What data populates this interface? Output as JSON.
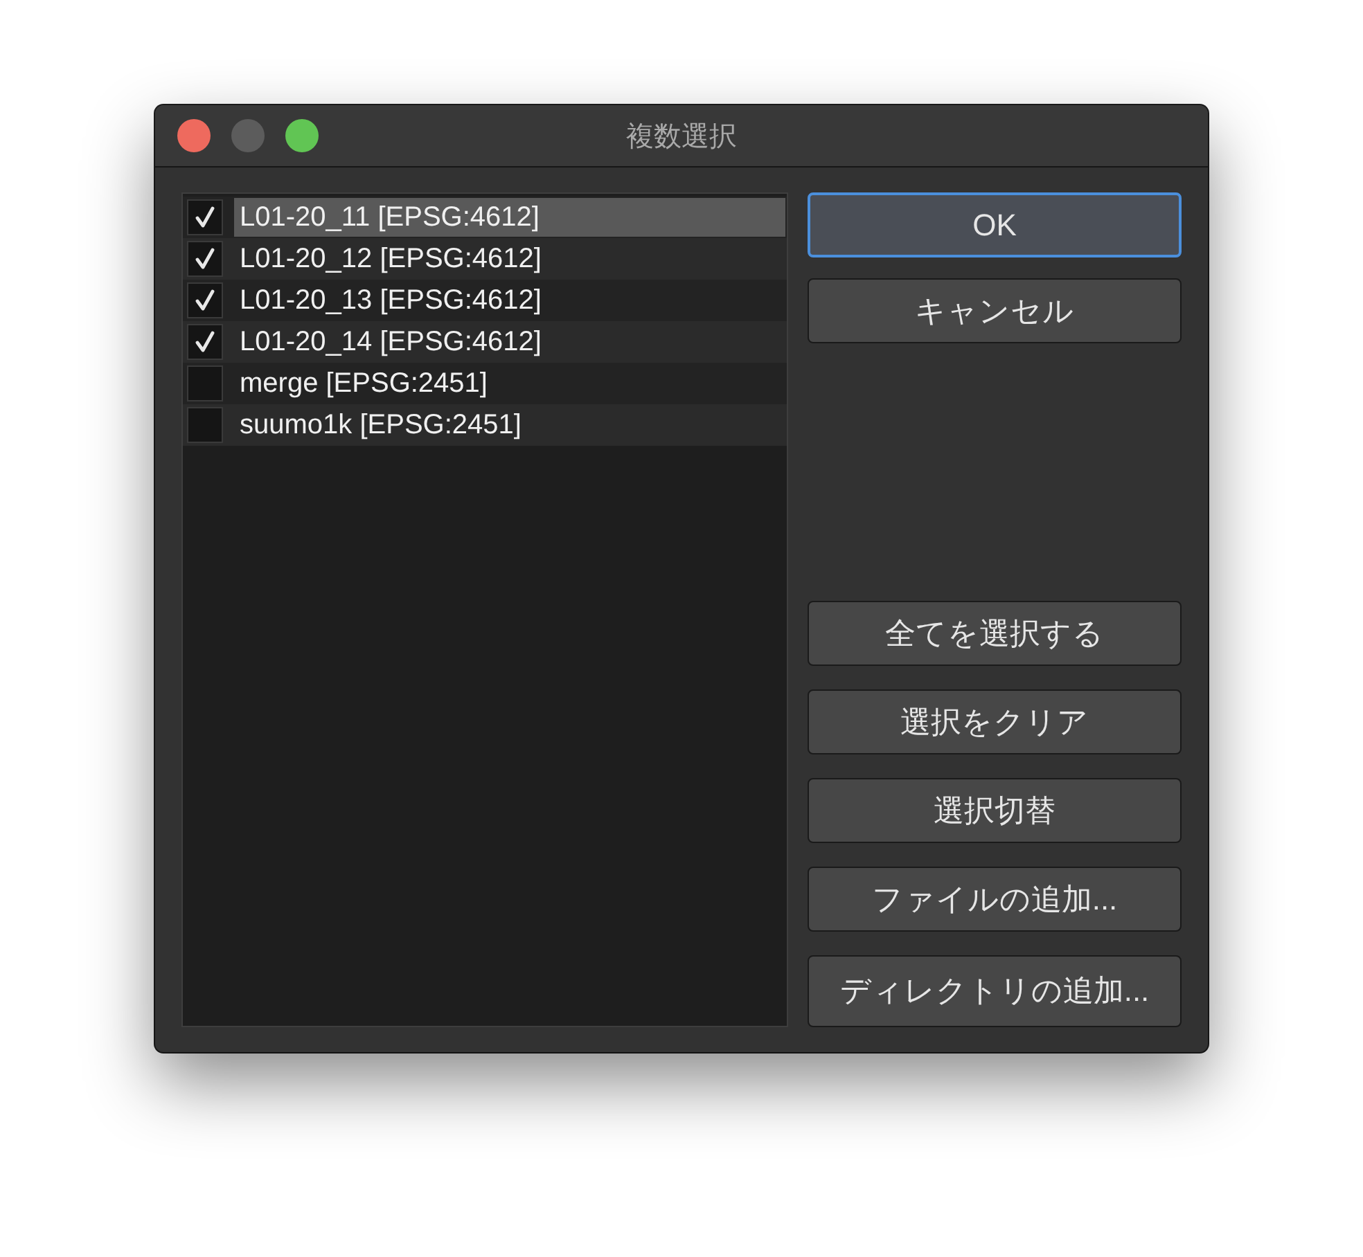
{
  "window": {
    "title": "複数選択"
  },
  "layers": [
    {
      "label": "L01-20_11 [EPSG:4612]",
      "checked": true,
      "selected": true
    },
    {
      "label": "L01-20_12 [EPSG:4612]",
      "checked": true,
      "selected": false
    },
    {
      "label": "L01-20_13 [EPSG:4612]",
      "checked": true,
      "selected": false
    },
    {
      "label": "L01-20_14 [EPSG:4612]",
      "checked": true,
      "selected": false
    },
    {
      "label": "merge [EPSG:2451]",
      "checked": false,
      "selected": false
    },
    {
      "label": "suumo1k [EPSG:2451]",
      "checked": false,
      "selected": false
    }
  ],
  "top_buttons": [
    {
      "label": "OK",
      "default": true
    },
    {
      "label": "キャンセル",
      "default": false
    }
  ],
  "bottom_buttons": [
    {
      "label": "全てを選択する"
    },
    {
      "label": "選択をクリア"
    },
    {
      "label": "選択切替"
    },
    {
      "label": "ファイルの追加..."
    },
    {
      "label": "ディレクトリの追加..."
    }
  ]
}
